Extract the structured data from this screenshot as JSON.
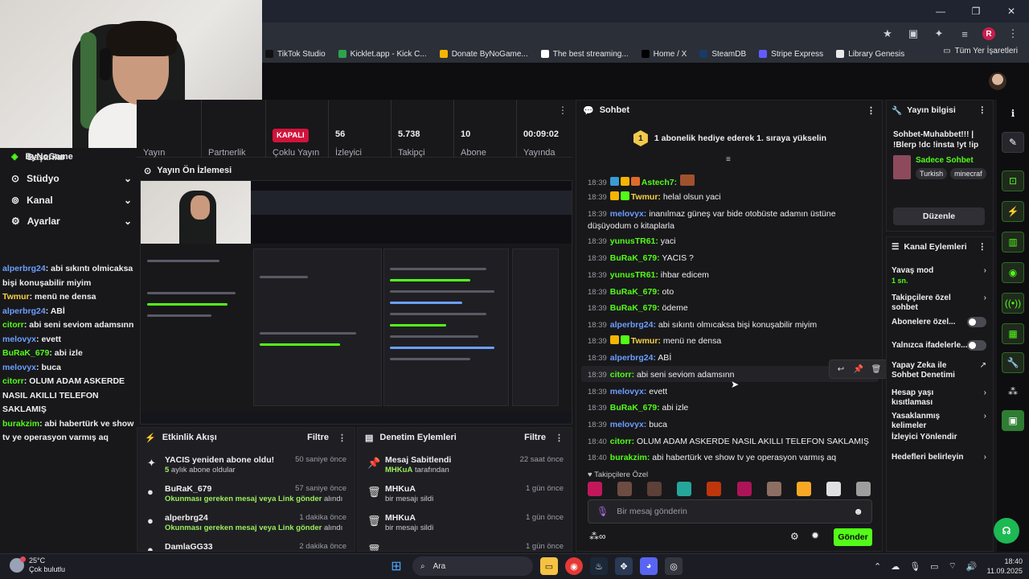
{
  "browser": {
    "bookmarks": [
      "TikTok Studio",
      "Kicklet.app - Kick C...",
      "Donate ByNoGame...",
      "The best streaming...",
      "Home / X",
      "SteamDB",
      "Stripe Express",
      "Library Genesis"
    ],
    "bookmark_colors": [
      "#111111",
      "#2fa34a",
      "#f5b400",
      "#ffffff",
      "#000000",
      "#1a3a66",
      "#635bff",
      "#e9e9e9"
    ],
    "all_bookmarks": "Tüm Yer İşaretleri",
    "profile_initial": "R"
  },
  "sidebar": {
    "brand": "ByNoGame",
    "overlay_item": "Başarılar",
    "items": [
      {
        "label": "Stüdyo",
        "icon": "studio-icon"
      },
      {
        "label": "Kanal",
        "icon": "channel-icon"
      },
      {
        "label": "Ayarlar",
        "icon": "gear-icon"
      }
    ]
  },
  "left_chat": [
    {
      "user": "alperbrg24",
      "text": ": abi sıkıntı olmicaksa bişi konuşabilir miyim",
      "cls": "b"
    },
    {
      "user": "Twmur",
      "text": ": menü ne densa",
      "cls": "y"
    },
    {
      "user": "alperbrg24",
      "text": ": ABİ",
      "cls": "b"
    },
    {
      "user": "citorr",
      "text": ": abi seni seviom adamsınn",
      "cls": "g"
    },
    {
      "user": "melovyx",
      "text": ": evett",
      "cls": "b"
    },
    {
      "user": "BuRaK_679",
      "text": ": abi izle",
      "cls": "g"
    },
    {
      "user": "melovyx",
      "text": ": buca",
      "cls": "b"
    },
    {
      "user": "citorr",
      "text": ": OLUM ADAM ASKERDE NASIL AKILLI TELEFON SAKLAMIŞ",
      "cls": "g"
    },
    {
      "user": "burakzim",
      "text": ": abi habertürk ve show tv ye operasyon varmış aq",
      "cls": "g"
    }
  ],
  "stats": {
    "labels": [
      "Yayın",
      "Partnerlik",
      "Çoklu Yayın",
      "İzleyici",
      "Takipçi",
      "Abone",
      "Yayında"
    ],
    "multistream_status": "KAPALI",
    "viewers": "56",
    "followers": "5.738",
    "subscribers": "10",
    "uptime": "00:09:02"
  },
  "preview": {
    "title": "Yayın Ön İzlemesi"
  },
  "activity": {
    "title": "Etkinlik Akışı",
    "filter": "Filtre",
    "events": [
      {
        "icon": "sparkle-icon",
        "title": "YACIS yeniden abone oldu!",
        "sub_bold": "5",
        "sub": " aylık abone oldular",
        "time": "50 saniye önce"
      },
      {
        "icon": "link-icon",
        "title": "BuRaK_679",
        "sub_bold": "Okunması gereken mesaj veya Link gönder",
        "sub": " alındı",
        "time": "57 saniye önce"
      },
      {
        "icon": "link-icon",
        "title": "alperbrg24",
        "sub_bold": "Okunması gereken mesaj veya Link gönder",
        "sub": " alındı",
        "time": "1 dakika önce"
      },
      {
        "icon": "link-icon",
        "title": "DamlaGG33",
        "sub_bold": "",
        "sub": "",
        "time": "2 dakika önce"
      }
    ]
  },
  "moderation": {
    "title": "Denetim Eylemleri",
    "filter": "Filtre",
    "events": [
      {
        "icon": "pin-icon",
        "title": "Mesaj Sabitlendi",
        "sub_bold": "MHKuA",
        "sub": " tarafından",
        "time": "22 saat önce"
      },
      {
        "icon": "trash-icon",
        "title": "MHKuA",
        "sub_bold": "",
        "sub": "bir mesajı sildi",
        "time": "1 gün önce"
      },
      {
        "icon": "trash-icon",
        "title": "MHKuA",
        "sub_bold": "",
        "sub": "bir mesajı sildi",
        "time": "1 gün önce"
      },
      {
        "icon": "trash-icon",
        "title": "",
        "sub_bold": "",
        "sub": "",
        "time": "1 gün önce"
      }
    ]
  },
  "chat": {
    "title": "Sohbet",
    "gift_badge": "1",
    "gift_text": "1 abonelik hediye ederek 1. sıraya yükselin",
    "messages": [
      {
        "time": "18:39",
        "user": "Astech7:",
        "text": "",
        "cls": "g",
        "badges": [
          "#3a9bd5",
          "#f5b400",
          "#e06a2c"
        ]
      },
      {
        "time": "18:39",
        "user": "Twmur:",
        "text": " helal olsun yaci",
        "cls": "y",
        "badges": [
          "#f5b400",
          "#53fc18"
        ]
      },
      {
        "time": "18:39",
        "user": "melovyx:",
        "text": " inanılmaz güneş var bide otobüste adamın üstüne düşüyodum o kitaplarla",
        "cls": "b",
        "badges": []
      },
      {
        "time": "18:39",
        "user": "yunusTR61:",
        "text": " yaci",
        "cls": "g",
        "badges": []
      },
      {
        "time": "18:39",
        "user": "BuRaK_679:",
        "text": " YACIS ?",
        "cls": "g",
        "badges": []
      },
      {
        "time": "18:39",
        "user": "yunusTR61:",
        "text": " ihbar edicem",
        "cls": "g",
        "badges": []
      },
      {
        "time": "18:39",
        "user": "BuRaK_679:",
        "text": " oto",
        "cls": "g",
        "badges": []
      },
      {
        "time": "18:39",
        "user": "BuRaK_679:",
        "text": " ödeme",
        "cls": "g",
        "badges": []
      },
      {
        "time": "18:39",
        "user": "alperbrg24:",
        "text": " abi sıkıntı olmıcaksa bişi konuşabilir miyim",
        "cls": "b",
        "badges": []
      },
      {
        "time": "18:39",
        "user": "Twmur:",
        "text": " menü ne densa",
        "cls": "y",
        "badges": [
          "#f5b400",
          "#53fc18"
        ]
      },
      {
        "time": "18:39",
        "user": "alperbrg24:",
        "text": " ABİ",
        "cls": "b",
        "badges": []
      },
      {
        "time": "18:39",
        "user": "citorr:",
        "text": " abi seni seviom adamsınn",
        "cls": "g",
        "badges": []
      },
      {
        "time": "18:39",
        "user": "melovyx:",
        "text": " evett",
        "cls": "b",
        "badges": []
      },
      {
        "time": "18:39",
        "user": "BuRaK_679:",
        "text": " abi izle",
        "cls": "g",
        "badges": []
      },
      {
        "time": "18:39",
        "user": "melovyx:",
        "text": " buca",
        "cls": "b",
        "badges": []
      },
      {
        "time": "18:40",
        "user": "citorr:",
        "text": " OLUM ADAM ASKERDE NASIL AKILLI TELEFON SAKLAMIŞ",
        "cls": "g",
        "badges": []
      },
      {
        "time": "18:40",
        "user": "burakzim:",
        "text": " abi habertürk ve show tv ye operasyon varmış aq",
        "cls": "g",
        "badges": []
      }
    ],
    "followers_label": "Takipçilere Özel",
    "input_placeholder": "Bir mesaj gönderin",
    "send_label": "Gönder"
  },
  "stream_info": {
    "title": "Yayın bilgisi",
    "stream_title": "Sohbet-Muhabbet!!! | !Blerp !dc !insta !yt !ip",
    "category": "Sadece Sohbet",
    "tags": [
      "Turkish",
      "minecraf"
    ],
    "edit_label": "Düzenle"
  },
  "channel_actions": {
    "title": "Kanal Eylemleri",
    "items": [
      {
        "label": "Yavaş mod",
        "sub": "1 sn.",
        "kind": "arrow"
      },
      {
        "label": "Takipçilere özel sohbet",
        "sub": "",
        "kind": "arrow"
      },
      {
        "label": "Abonelere özel...",
        "sub": "",
        "kind": "toggle"
      },
      {
        "label": "Yalnızca ifadelerle...",
        "sub": "",
        "kind": "toggle"
      },
      {
        "label": "Yapay Zeka ile Sohbet Denetimi",
        "sub": "",
        "kind": "external"
      },
      {
        "label": "Hesap yaşı kısıtlaması",
        "sub": "",
        "kind": "arrow"
      },
      {
        "label": "Yasaklanmış kelimeler",
        "sub": "",
        "kind": "arrow"
      },
      {
        "label": "İzleyici Yönlendir",
        "sub": "",
        "kind": "none"
      },
      {
        "label": "Hedefleri belirleyin",
        "sub": "",
        "kind": "arrow"
      }
    ]
  },
  "taskbar": {
    "temp": "25°C",
    "weather": "Çok bulutlu",
    "search": "Ara",
    "time": "18:40",
    "date": "11.09.2025"
  }
}
